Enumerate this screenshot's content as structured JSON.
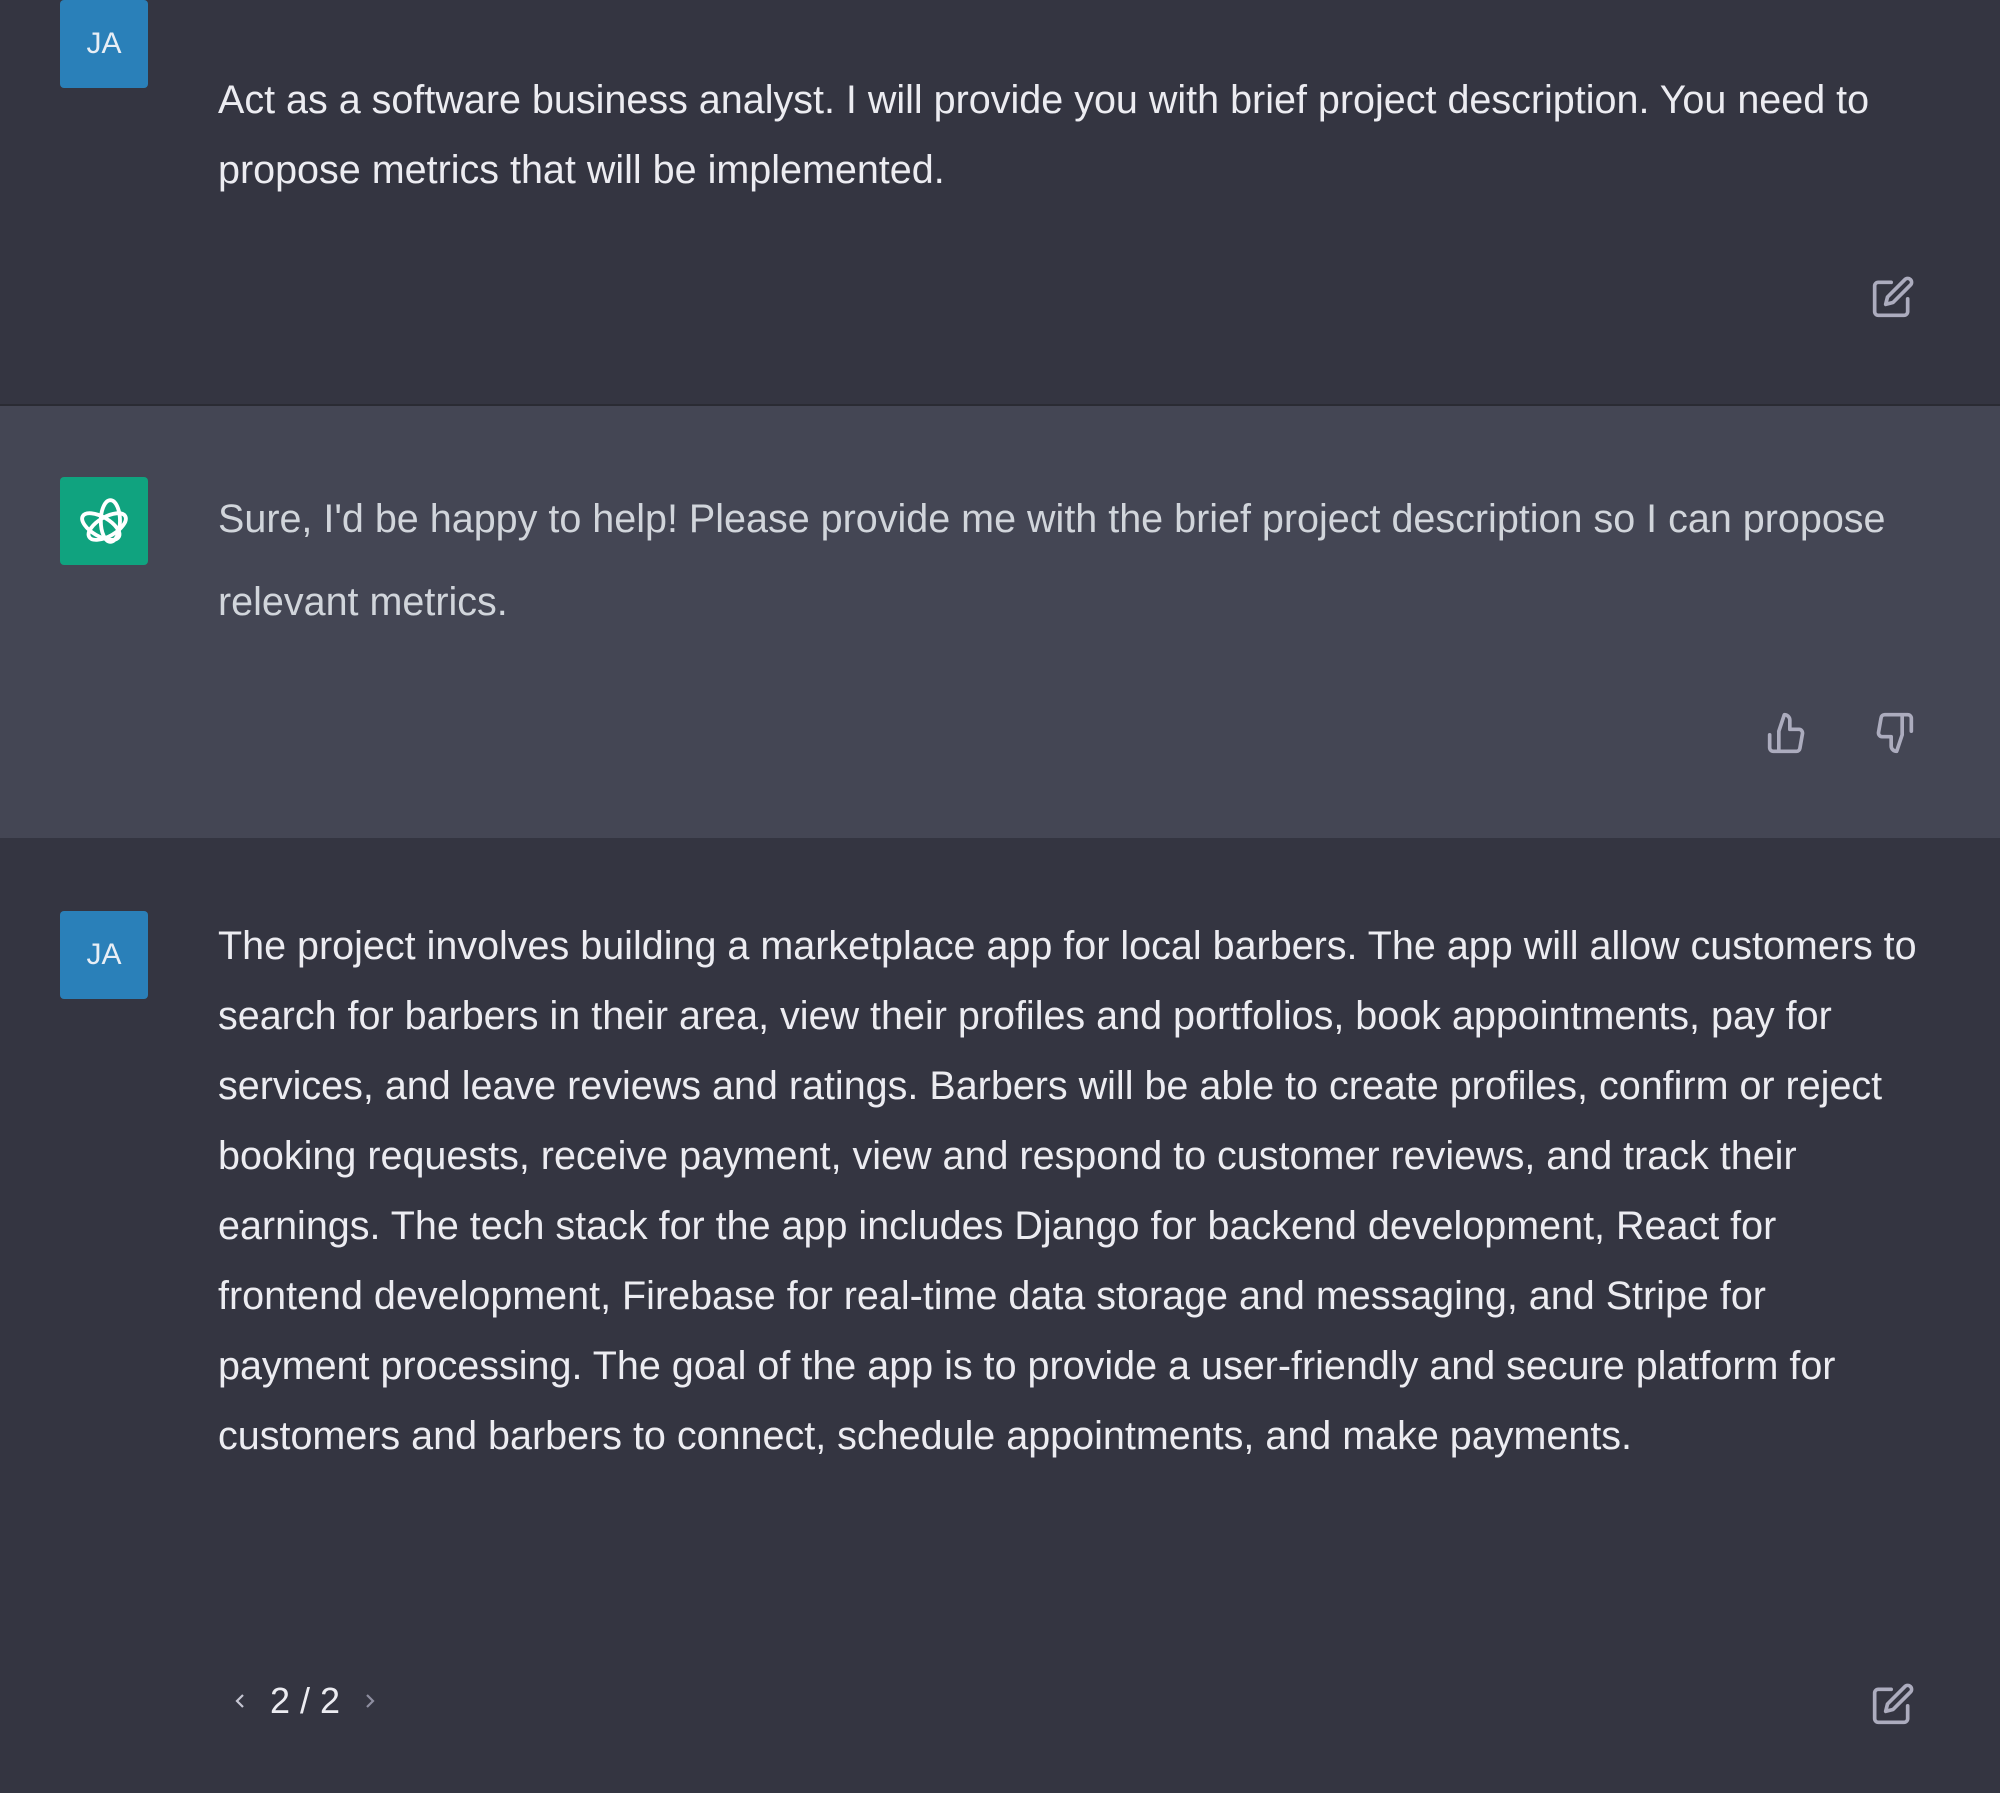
{
  "colors": {
    "user_bg": "#343541",
    "assistant_bg": "#444654",
    "user_avatar": "#2a80b9",
    "assistant_avatar": "#10a37f"
  },
  "messages": [
    {
      "role": "user",
      "avatar": "JA",
      "text": "Act as a software business analyst. I will provide you with brief project description. You need to propose metrics that will be implemented.",
      "actions": [
        "edit-icon"
      ]
    },
    {
      "role": "assistant",
      "avatar_icon": "openai-logo-icon",
      "text": "Sure, I'd be happy to help! Please provide me with the brief project description so I can propose relevant metrics.",
      "actions": [
        "thumbs-up-icon",
        "thumbs-down-icon"
      ]
    },
    {
      "role": "user",
      "avatar": "JA",
      "text": "The project involves building a marketplace app for local barbers. The app will allow customers to search for barbers in their area, view their profiles and portfolios, book appointments, pay for services, and leave reviews and ratings. Barbers will be able to create profiles, confirm or reject booking requests, receive payment, view and respond to customer reviews, and track their earnings. The tech stack for the app includes Django for backend development, React for frontend development, Firebase for real-time data storage and messaging, and Stripe for payment processing. The goal of the app is to provide a user-friendly and secure platform for customers and barbers to connect, schedule appointments, and make payments.",
      "pagination": "2 / 2",
      "actions": [
        "edit-icon"
      ]
    }
  ]
}
